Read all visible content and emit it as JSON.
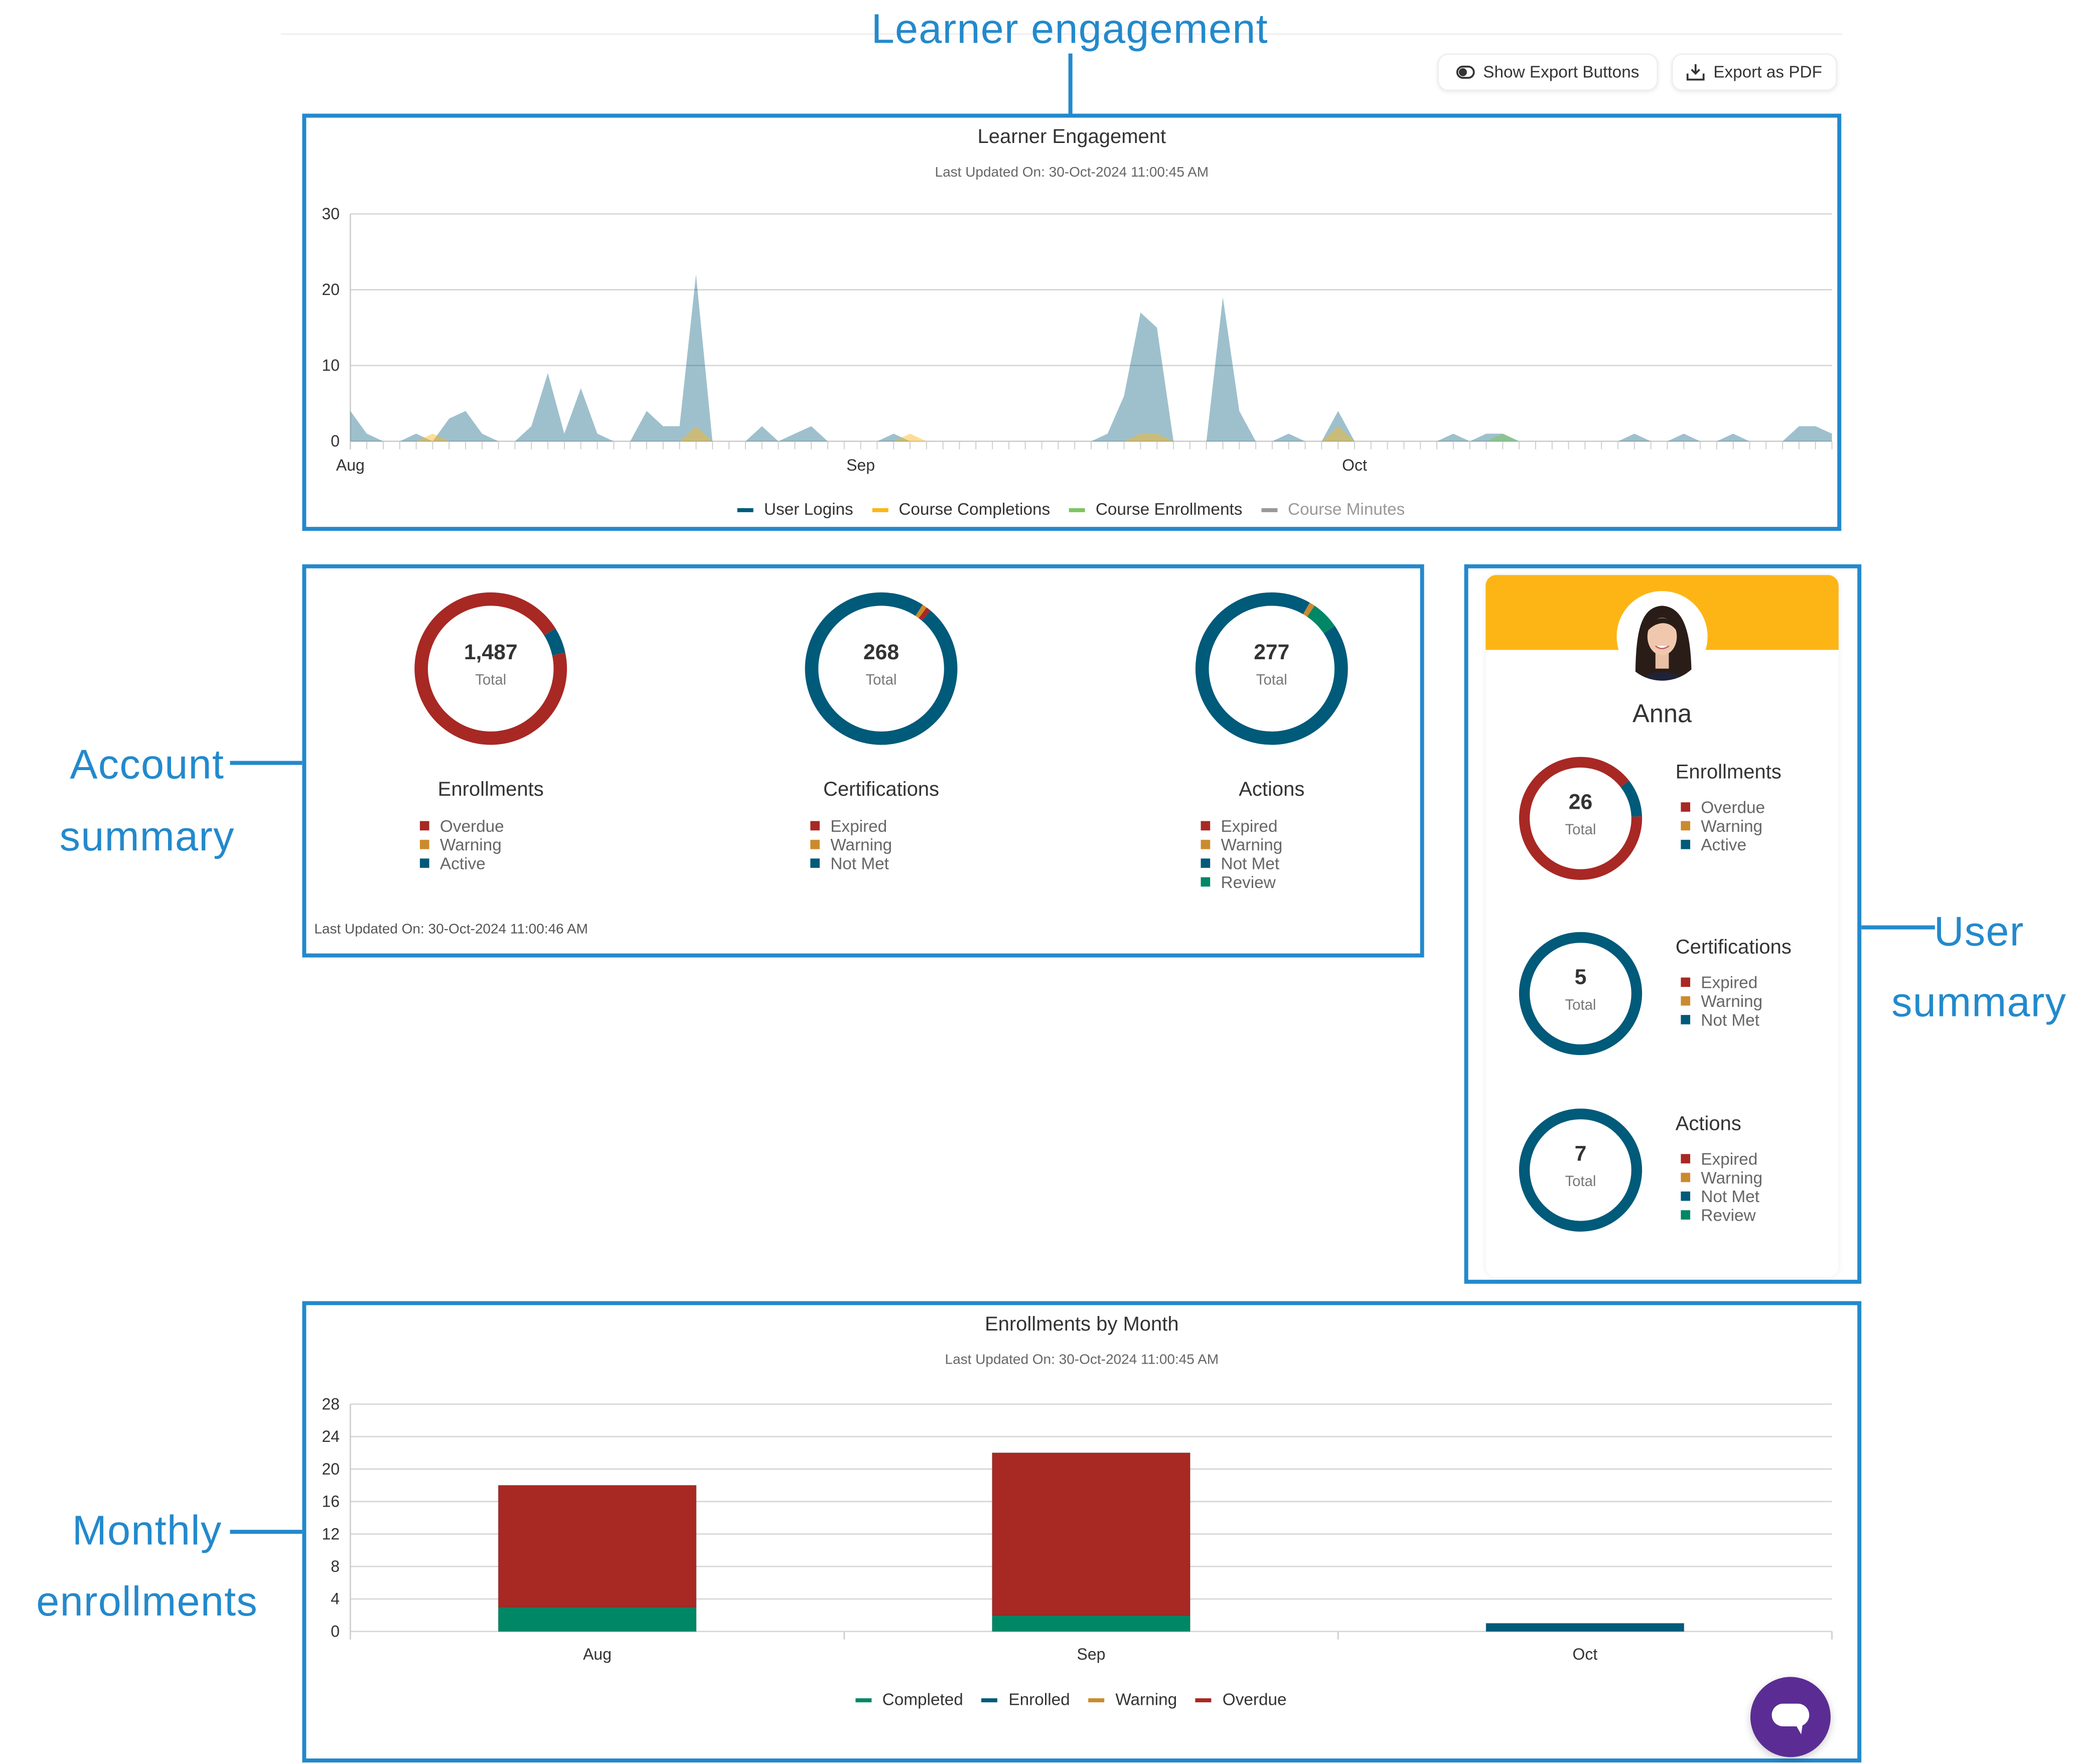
{
  "annotations": {
    "learner_engagement": "Learner engagement",
    "account_summary": [
      "Account",
      "summary"
    ],
    "user_summary": [
      "User",
      "summary"
    ],
    "monthly_enrollments": [
      "Monthly",
      "enrollments"
    ],
    "chat_icon": "Chat icon"
  },
  "toolbar": {
    "show_export_label": "Show Export Buttons",
    "show_export_icon": "toggle-icon",
    "export_pdf_label": "Export as PDF",
    "export_pdf_icon": "download-tray-icon"
  },
  "colors": {
    "annotation": "#2389cc",
    "overdue": "#a82824",
    "warning": "#cc8a2e",
    "active": "#005a7a",
    "review": "#008765",
    "user_header": "#fdb516",
    "chat": "#5b2d94"
  },
  "learner_engagement": {
    "title": "Learner Engagement",
    "updated": "Last Updated On: 30-Oct-2024 11:00:45 AM"
  },
  "account_summary": {
    "updated": "Last Updated On: 30-Oct-2024 11:00:46 AM",
    "donuts": [
      {
        "title": "Enrollments",
        "total": "1,487",
        "total_label": "Total",
        "legend": [
          {
            "label": "Overdue",
            "color": "#a82824"
          },
          {
            "label": "Warning",
            "color": "#cc8a2e"
          },
          {
            "label": "Active",
            "color": "#005a7a"
          }
        ],
        "segments": [
          {
            "label": "Active",
            "fraction": 0.055
          },
          {
            "label": "Warning",
            "fraction": 0
          },
          {
            "label": "Overdue",
            "fraction": 0.945
          }
        ]
      },
      {
        "title": "Certifications",
        "total": "268",
        "total_label": "Total",
        "legend": [
          {
            "label": "Expired",
            "color": "#a82824"
          },
          {
            "label": "Warning",
            "color": "#cc8a2e"
          },
          {
            "label": "Not Met",
            "color": "#005a7a"
          }
        ],
        "segments": [
          {
            "label": "Warning",
            "fraction": 0.01
          },
          {
            "label": "Expired",
            "fraction": 0.01
          },
          {
            "label": "Not Met",
            "fraction": 0.98
          }
        ]
      },
      {
        "title": "Actions",
        "total": "277",
        "total_label": "Total",
        "legend": [
          {
            "label": "Expired",
            "color": "#a82824"
          },
          {
            "label": "Warning",
            "color": "#cc8a2e"
          },
          {
            "label": "Not Met",
            "color": "#005a7a"
          },
          {
            "label": "Review",
            "color": "#008765"
          }
        ],
        "segments": [
          {
            "label": "Warning",
            "fraction": 0.012
          },
          {
            "label": "Review",
            "fraction": 0.06
          },
          {
            "label": "Not Met",
            "fraction": 0.928
          }
        ]
      }
    ]
  },
  "user_summary": {
    "name": "Anna",
    "donuts": [
      {
        "title": "Enrollments",
        "total": "26",
        "total_label": "Total",
        "legend": [
          {
            "label": "Overdue",
            "color": "#a82824"
          },
          {
            "label": "Warning",
            "color": "#cc8a2e"
          },
          {
            "label": "Active",
            "color": "#005a7a"
          }
        ],
        "segments": [
          {
            "label": "Active",
            "fraction": 0.1
          },
          {
            "label": "Overdue",
            "fraction": 0.9
          }
        ]
      },
      {
        "title": "Certifications",
        "total": "5",
        "total_label": "Total",
        "legend": [
          {
            "label": "Expired",
            "color": "#a82824"
          },
          {
            "label": "Warning",
            "color": "#cc8a2e"
          },
          {
            "label": "Not Met",
            "color": "#005a7a"
          }
        ],
        "segments": [
          {
            "label": "Not Met",
            "fraction": 1
          }
        ]
      },
      {
        "title": "Actions",
        "total": "7",
        "total_label": "Total",
        "legend": [
          {
            "label": "Expired",
            "color": "#a82824"
          },
          {
            "label": "Warning",
            "color": "#cc8a2e"
          },
          {
            "label": "Not Met",
            "color": "#005a7a"
          },
          {
            "label": "Review",
            "color": "#008765"
          }
        ],
        "segments": [
          {
            "label": "Not Met",
            "fraction": 1
          }
        ]
      }
    ]
  },
  "monthly_enrollments": {
    "title": "Enrollments by Month",
    "updated": "Last Updated On: 30-Oct-2024 11:00:45 AM"
  },
  "chat": {
    "icon": "chat-bubble-icon"
  },
  "chart_data": [
    {
      "type": "area",
      "title": "Learner Engagement",
      "x_tick_labels": [
        "Aug",
        "Sep",
        "Oct"
      ],
      "x": [
        "Aug 1",
        "Aug 2",
        "Aug 3",
        "Aug 4",
        "Aug 5",
        "Aug 6",
        "Aug 7",
        "Aug 8",
        "Aug 9",
        "Aug 10",
        "Aug 11",
        "Aug 12",
        "Aug 13",
        "Aug 14",
        "Aug 15",
        "Aug 16",
        "Aug 17",
        "Aug 18",
        "Aug 19",
        "Aug 20",
        "Aug 21",
        "Aug 22",
        "Aug 23",
        "Aug 24",
        "Aug 25",
        "Aug 26",
        "Aug 27",
        "Aug 28",
        "Aug 29",
        "Aug 30",
        "Aug 31",
        "Sep 1",
        "Sep 2",
        "Sep 3",
        "Sep 4",
        "Sep 5",
        "Sep 6",
        "Sep 7",
        "Sep 8",
        "Sep 9",
        "Sep 10",
        "Sep 11",
        "Sep 12",
        "Sep 13",
        "Sep 14",
        "Sep 15",
        "Sep 16",
        "Sep 17",
        "Sep 18",
        "Sep 19",
        "Sep 20",
        "Sep 21",
        "Sep 22",
        "Sep 23",
        "Sep 24",
        "Sep 25",
        "Sep 26",
        "Sep 27",
        "Sep 28",
        "Sep 29",
        "Sep 30",
        "Oct 1",
        "Oct 2",
        "Oct 3",
        "Oct 4",
        "Oct 5",
        "Oct 6",
        "Oct 7",
        "Oct 8",
        "Oct 9",
        "Oct 10",
        "Oct 11",
        "Oct 12",
        "Oct 13",
        "Oct 14",
        "Oct 15",
        "Oct 16",
        "Oct 17",
        "Oct 18",
        "Oct 19",
        "Oct 20",
        "Oct 21",
        "Oct 22",
        "Oct 23",
        "Oct 24",
        "Oct 25",
        "Oct 26",
        "Oct 27",
        "Oct 28",
        "Oct 29",
        "Oct 30"
      ],
      "ylim": [
        0,
        30
      ],
      "y_ticks": [
        0,
        10,
        20,
        30
      ],
      "grid": true,
      "legend_position": "bottom",
      "series": [
        {
          "name": "User Logins",
          "color": "#005a7a",
          "visible": true,
          "values": [
            4,
            1,
            0,
            0,
            1,
            0,
            3,
            4,
            1,
            0,
            0,
            2,
            9,
            1,
            7,
            1,
            0,
            0,
            4,
            2,
            2,
            22,
            0,
            0,
            0,
            2,
            0,
            1,
            2,
            0,
            0,
            0,
            0,
            1,
            0,
            0,
            0,
            0,
            0,
            0,
            0,
            0,
            0,
            0,
            0,
            0,
            1,
            6,
            17,
            15,
            0,
            0,
            0,
            19,
            4,
            0,
            0,
            1,
            0,
            0,
            4,
            0,
            0,
            0,
            0,
            0,
            0,
            1,
            0,
            1,
            1,
            0,
            0,
            0,
            0,
            0,
            0,
            0,
            1,
            0,
            0,
            1,
            0,
            0,
            1,
            0,
            0,
            0,
            2,
            2,
            1
          ]
        },
        {
          "name": "Course Completions",
          "color": "#fdb516",
          "visible": true,
          "values": [
            0,
            0,
            0,
            0,
            0,
            1,
            0,
            0,
            0,
            0,
            0,
            0,
            0,
            0,
            0,
            0,
            0,
            0,
            0,
            0,
            0,
            2,
            0,
            0,
            0,
            0,
            0,
            0,
            0,
            0,
            0,
            0,
            0,
            0,
            1,
            0,
            0,
            0,
            0,
            0,
            0,
            0,
            0,
            0,
            0,
            0,
            0,
            0,
            1,
            1,
            0,
            0,
            0,
            0,
            0,
            0,
            0,
            0,
            0,
            0,
            2,
            0,
            0,
            0,
            0,
            0,
            0,
            0,
            0,
            0,
            0,
            0,
            0,
            0,
            0,
            0,
            0,
            0,
            0,
            0,
            0,
            0,
            0,
            0,
            0,
            0,
            0,
            0,
            0,
            0,
            0
          ]
        },
        {
          "name": "Course Enrollments",
          "color": "#7dc462",
          "visible": true,
          "values": [
            0,
            0,
            0,
            0,
            0,
            0,
            0,
            0,
            0,
            0,
            0,
            0,
            0,
            0,
            0,
            0,
            0,
            0,
            0,
            0,
            0,
            0,
            0,
            0,
            0,
            0,
            0,
            0,
            0,
            0,
            0,
            0,
            0,
            0,
            0,
            0,
            0,
            0,
            0,
            0,
            0,
            0,
            0,
            0,
            0,
            0,
            0,
            0,
            0,
            0,
            0,
            0,
            0,
            0,
            0,
            0,
            0,
            0,
            0,
            0,
            0,
            0,
            0,
            0,
            0,
            0,
            0,
            0,
            0,
            0,
            1,
            0,
            0,
            0,
            0,
            0,
            0,
            0,
            0,
            0,
            0,
            0,
            0,
            0,
            0,
            0,
            0,
            0,
            0,
            0,
            0
          ]
        },
        {
          "name": "Course Minutes",
          "color": "#999999",
          "visible": false,
          "values": []
        }
      ]
    },
    {
      "type": "bar",
      "stacked": true,
      "title": "Enrollments by Month",
      "categories": [
        "Aug",
        "Sep",
        "Oct"
      ],
      "ylim": [
        0,
        28
      ],
      "y_ticks": [
        0,
        4,
        8,
        12,
        16,
        20,
        24,
        28
      ],
      "grid": true,
      "legend_position": "bottom",
      "series": [
        {
          "name": "Completed",
          "color": "#008765",
          "values": [
            3,
            2,
            0
          ]
        },
        {
          "name": "Enrolled",
          "color": "#005a7a",
          "values": [
            0,
            0,
            1
          ]
        },
        {
          "name": "Warning",
          "color": "#cc8a2e",
          "values": [
            0,
            0,
            0
          ]
        },
        {
          "name": "Overdue",
          "color": "#a82824",
          "values": [
            15,
            20,
            0
          ]
        }
      ]
    }
  ]
}
